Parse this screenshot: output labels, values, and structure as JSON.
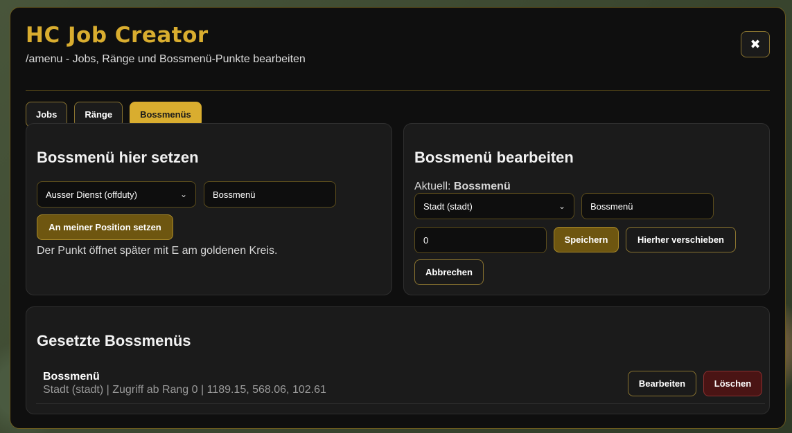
{
  "header": {
    "title": "HC Job Creator",
    "subtitle": "/amenu - Jobs, Ränge und Bossmenü-Punkte bearbeiten",
    "close_glyph": "✖"
  },
  "tabs": [
    {
      "label": "Jobs"
    },
    {
      "label": "Ränge"
    },
    {
      "label": "Bossmenüs",
      "active": true
    }
  ],
  "set_panel": {
    "title": "Bossmenü hier setzen",
    "job_select": "Ausser Dienst (offduty)",
    "name_value": "Bossmenü",
    "place_button": "An meiner Position setzen",
    "hint": "Der Punkt öffnet später mit E am goldenen Kreis."
  },
  "edit_panel": {
    "title": "Bossmenü bearbeiten",
    "current_label": "Aktuell:",
    "current_value": "Bossmenü",
    "job_select": "Stadt (stadt)",
    "name_value": "Bossmenü",
    "rank_value": "0",
    "save_button": "Speichern",
    "move_button": "Hierher verschieben",
    "cancel_button": "Abbrechen"
  },
  "list_panel": {
    "title": "Gesetzte Bossmenüs",
    "items": [
      {
        "name": "Bossmenü",
        "meta": "Stadt (stadt) | Zugriff ab Rang 0 | 1189.15, 568.06, 102.61",
        "edit_button": "Bearbeiten",
        "delete_button": "Löschen"
      }
    ]
  },
  "colors": {
    "accent": "#d9ad2f",
    "panel": "#1b1b1b",
    "window": "#0f0f0f",
    "danger": "#4a1414"
  }
}
